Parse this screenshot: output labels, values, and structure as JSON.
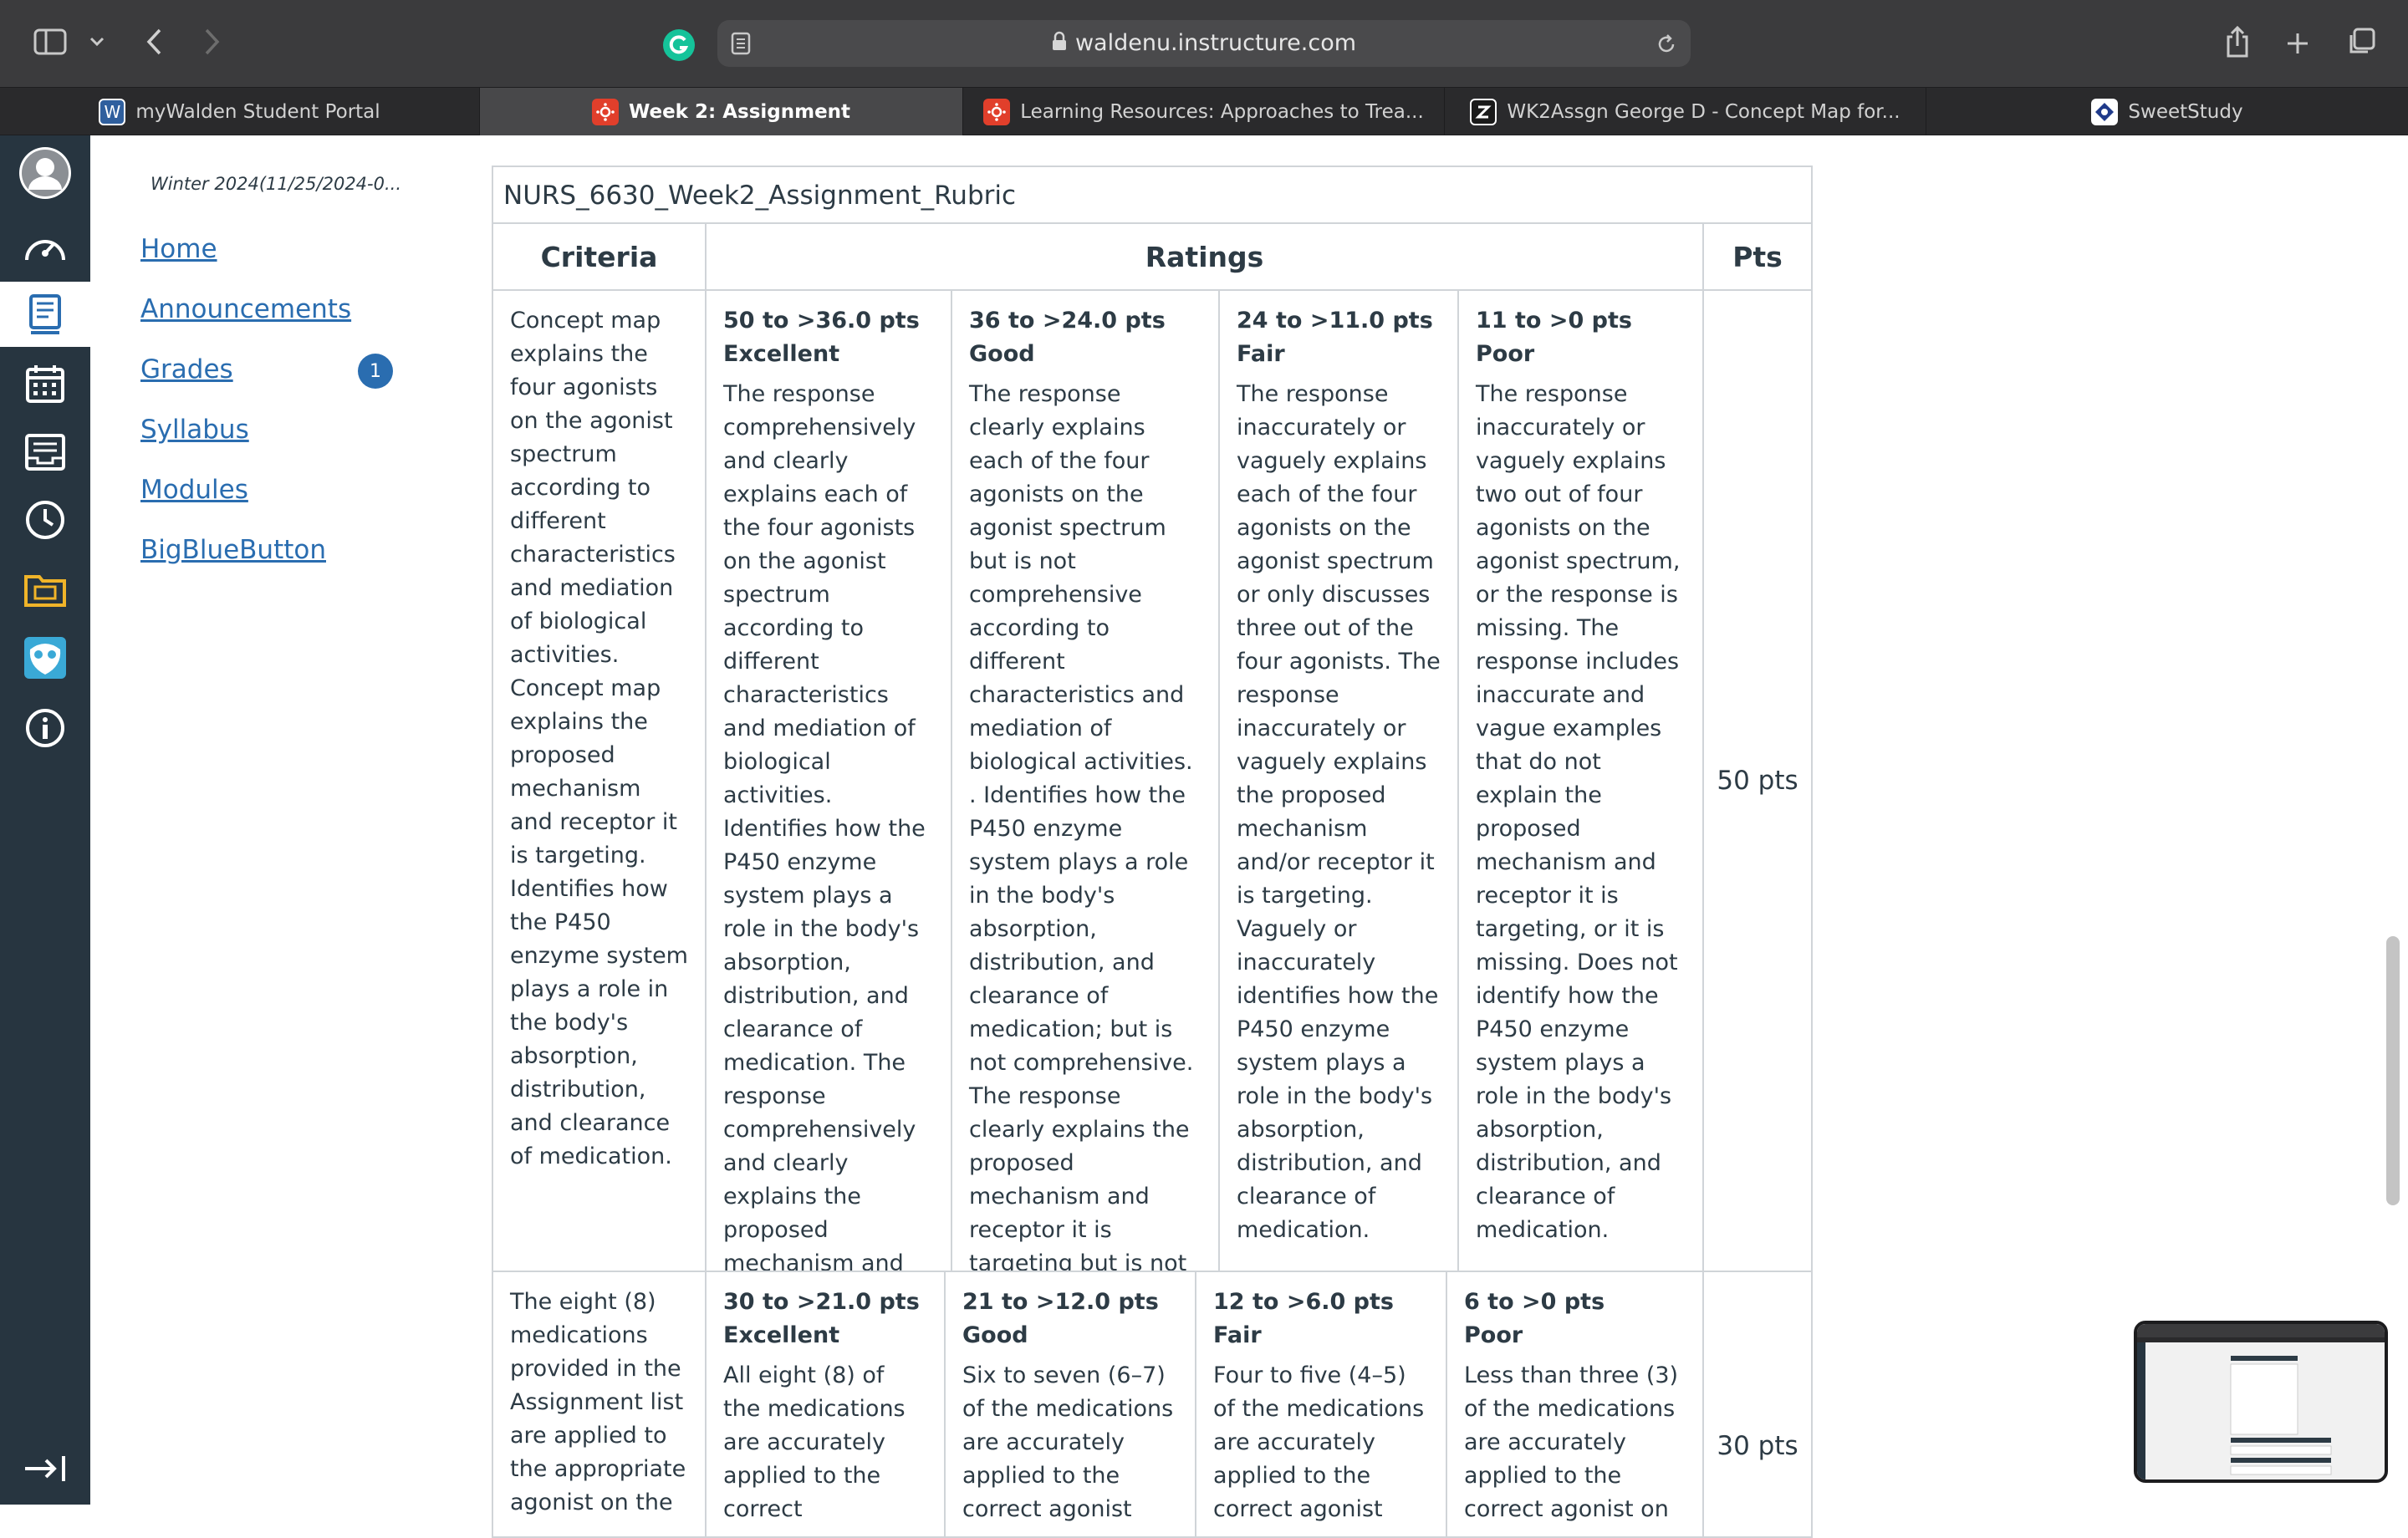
{
  "browser": {
    "url": "waldenu.instructure.com",
    "tabs": [
      {
        "label": "myWalden Student Portal",
        "icon": "walden-w-icon"
      },
      {
        "label": "Week 2: Assignment",
        "icon": "canvas-icon",
        "active": true
      },
      {
        "label": "Learning Resources: Approaches to Trea...",
        "icon": "canvas-icon"
      },
      {
        "label": "WK2Assgn George D - Concept Map for...",
        "icon": "doc-icon"
      },
      {
        "label": "SweetStudy",
        "icon": "sweetstudy-icon"
      }
    ],
    "tab_icon_glyphs": {
      "walden": "W"
    }
  },
  "course_nav": {
    "term": "Winter 2024(11/25/2024-0...",
    "items": [
      {
        "label": "Home"
      },
      {
        "label": "Announcements"
      },
      {
        "label": "Grades",
        "badge": "1"
      },
      {
        "label": "Syllabus"
      },
      {
        "label": "Modules"
      },
      {
        "label": "BigBlueButton"
      }
    ]
  },
  "rubric": {
    "title": "NURS_6630_Week2_Assignment_Rubric",
    "headers": {
      "criteria": "Criteria",
      "ratings": "Ratings",
      "pts": "Pts"
    },
    "rows": [
      {
        "criteria": "Concept map explains the four agonists on the agonist spectrum according to different characteristics and mediation of biological activities. Concept map explains the proposed mechanism and receptor it is targeting. Identifies how the P450 enzyme system plays a role in the body's absorption, distribution, and clearance of medication.",
        "ratings": [
          {
            "range": "50 to >36.0 pts",
            "name": "Excellent",
            "desc": "The response comprehensively and clearly explains each of the four agonists on the agonist spectrum according to different characteristics and mediation of biological activities. Identifies how the P450 enzyme system plays a role in the body's absorption, distribution, and clearance of medication. The response comprehensively and clearly explains the proposed mechanism and receptor it is targeting."
          },
          {
            "range": "36 to >24.0 pts",
            "name": "Good",
            "desc": "The response clearly explains each of the four agonists on the agonist spectrum but is not comprehensive according to different characteristics and mediation of biological activities. . Identifies how the P450 enzyme system plays a role in the body's absorption, distribution, and clearance of medication; but is not comprehensive. The response clearly explains the proposed mechanism and receptor it is targeting but is not comprehensive."
          },
          {
            "range": "24 to >11.0 pts",
            "name": "Fair",
            "desc": "The response inaccurately or vaguely explains each of the four agonists on the agonist spectrum or only discusses three out of the four agonists. The response inaccurately or vaguely explains the proposed mechanism and/or receptor it is targeting. Vaguely or inaccurately identifies how the P450 enzyme system plays a role in the body's absorption, distribution, and clearance of medication."
          },
          {
            "range": "11 to >0 pts",
            "name": "Poor",
            "desc": "The response inaccurately or vaguely explains two out of four agonists on the agonist spectrum, or the response is missing. The response includes inaccurate and vague examples that do not explain the proposed mechanism and receptor it is targeting, or it is missing. Does not identify how the P450 enzyme system plays a role in the body's absorption, distribution, and clearance of medication."
          }
        ],
        "pts": "50 pts"
      },
      {
        "criteria": "The eight (8) medications provided in the Assignment list are applied to the appropriate agonist on the",
        "ratings": [
          {
            "range": "30 to >21.0 pts",
            "name": "Excellent",
            "desc": "All eight (8) of the medications are accurately applied to the correct"
          },
          {
            "range": "21 to >12.0 pts",
            "name": "Good",
            "desc": "Six to seven (6–7) of the medications are accurately applied to the correct agonist"
          },
          {
            "range": "12 to >6.0 pts",
            "name": "Fair",
            "desc": "Four to five (4–5) of the medications are accurately applied to the correct agonist"
          },
          {
            "range": "6 to >0 pts",
            "name": "Poor",
            "desc": "Less than three (3) of the medications are accurately applied to the correct agonist on"
          }
        ],
        "pts": "30 pts"
      }
    ]
  },
  "colors": {
    "canvas_nav": "#273540",
    "link": "#2a6db0",
    "border": "#d0d4d8",
    "text": "#2d3b45"
  }
}
